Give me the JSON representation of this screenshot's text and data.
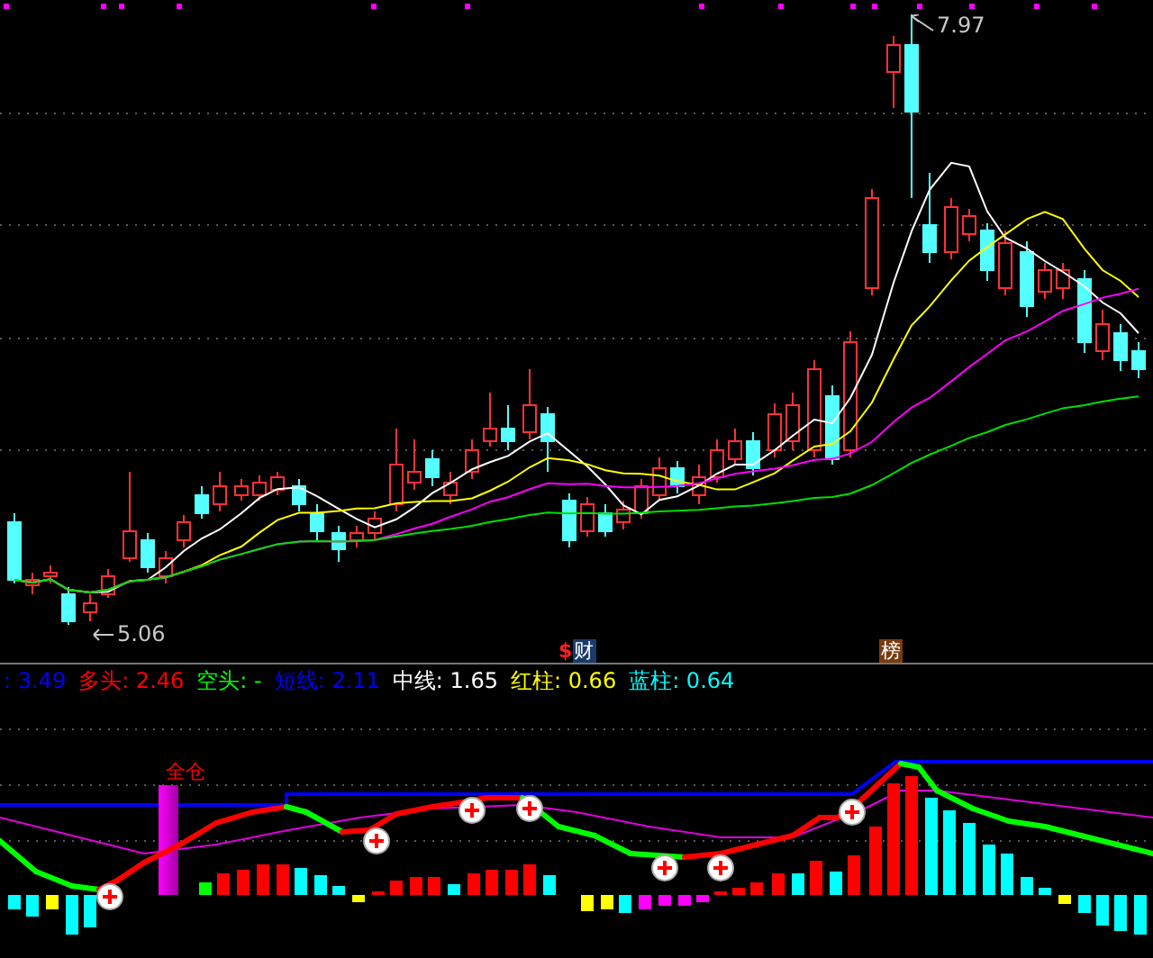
{
  "price_chart": {
    "high_label": "7.97",
    "low_label": "5.06",
    "badges": [
      {
        "kind": "finance",
        "mark": "$",
        "text": "财"
      },
      {
        "kind": "rank",
        "text": "榜"
      }
    ]
  },
  "indicator_legend": [
    {
      "label": ": 3.49",
      "color": "#0000ff"
    },
    {
      "label": "多头: 2.46",
      "color": "#ff0000"
    },
    {
      "label": "空头: -",
      "color": "#00ff00"
    },
    {
      "label": "短线: 2.11",
      "color": "#0000ff"
    },
    {
      "label": "中线: 1.65",
      "color": "#ffffff"
    },
    {
      "label": "红柱: 0.66",
      "color": "#ffff00"
    },
    {
      "label": "蓝柱: 0.64",
      "color": "#00ffff"
    }
  ],
  "indicator_chart": {
    "signal_label": "全仓"
  }
}
